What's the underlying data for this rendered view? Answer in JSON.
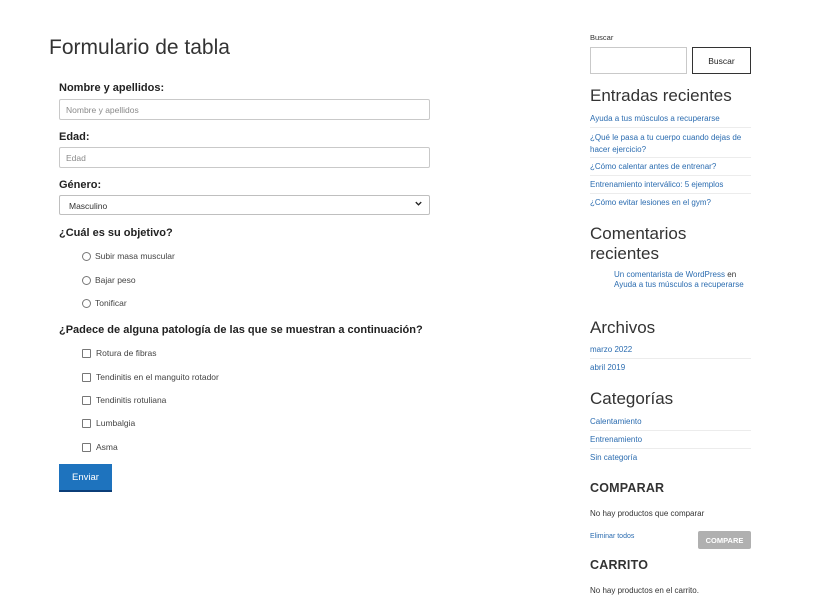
{
  "form": {
    "title": "Formulario de tabla",
    "name_label": "Nombre y apellidos:",
    "name_placeholder": "Nombre y apellidos",
    "age_label": "Edad:",
    "age_placeholder": "Edad",
    "gender_label": "Género:",
    "gender_value": "Masculino",
    "goal_label": "¿Cuál es su objetivo?",
    "goals": [
      "Subir masa muscular",
      "Bajar peso",
      "Tonificar"
    ],
    "pathology_label": "¿Padece de alguna patología de las que se muestran a continuación?",
    "pathologies": [
      "Rotura de fibras",
      "Tendinitis en el manguito rotador",
      "Tendinitis rotuliana",
      "Lumbalgia",
      "Asma"
    ],
    "submit_label": "Enviar"
  },
  "sidebar": {
    "search_label": "Buscar",
    "search_button": "Buscar",
    "recent_posts_title": "Entradas recientes",
    "recent_posts": [
      "Ayuda a tus músculos a recuperarse",
      "¿Qué le pasa a tu cuerpo cuando dejas de hacer ejercicio?",
      "¿Cómo calentar antes de entrenar?",
      "Entrenamiento interválico: 5 ejemplos",
      "¿Cómo evitar lesiones en el gym?"
    ],
    "recent_comments_title_line1": "Comentarios",
    "recent_comments_title_line2": "recientes",
    "comment_author": "Un comentarista de WordPress",
    "comment_connector": "en",
    "comment_post": "Ayuda a tus músculos a recuperarse",
    "archives_title": "Archivos",
    "archives": [
      "marzo 2022",
      "abril 2019"
    ],
    "categories_title": "Categorías",
    "categories": [
      "Calentamiento",
      "Entrenamiento",
      "Sin categoría"
    ],
    "compare_title": "COMPARAR",
    "compare_empty": "No hay productos que comparar",
    "compare_clear": "Eliminar todos",
    "compare_button": "COMPARE",
    "cart_title": "CARRITO",
    "cart_empty": "No hay productos en el carrito."
  },
  "colors": {
    "accent": "#1e73be",
    "link": "#2b6cb0",
    "disabled_button": "#b0b0b0"
  }
}
